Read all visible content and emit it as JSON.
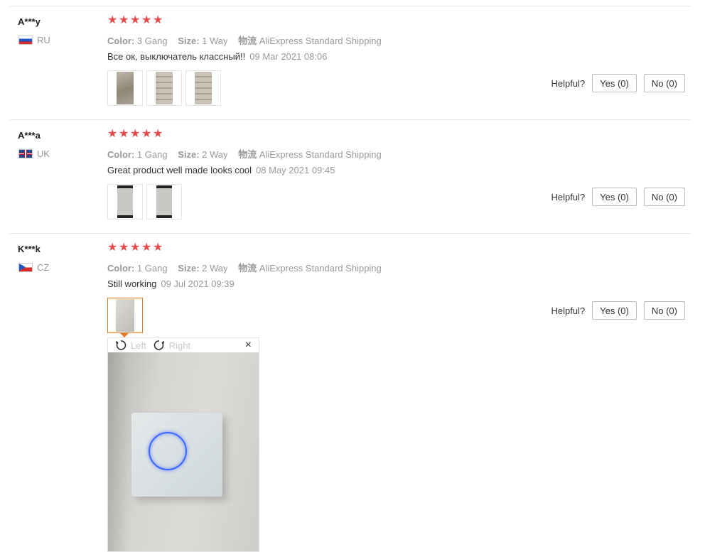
{
  "helpful_label": "Helpful?",
  "star_color": "#e94a4a",
  "reviews": [
    {
      "user": "A***y",
      "country": "RU",
      "flag_icon": "ru-flag-icon",
      "rating": 5,
      "color_label": "Color:",
      "color_value": "3 Gang",
      "size_label": "Size:",
      "size_value": "1 Way",
      "shipping_label": "物流",
      "shipping_value": "AliExpress Standard Shipping",
      "comment": "Все ок, выключатель классный!!",
      "date": "09 Mar 2021 08:06",
      "yes": "Yes (0)",
      "no": "No (0)"
    },
    {
      "user": "A***a",
      "country": "UK",
      "flag_icon": "uk-flag-icon",
      "rating": 5,
      "color_label": "Color:",
      "color_value": "1 Gang",
      "size_label": "Size:",
      "size_value": "2 Way",
      "shipping_label": "物流",
      "shipping_value": "AliExpress Standard Shipping",
      "comment": "Great product well made looks cool",
      "date": "08 May 2021 09:45",
      "yes": "Yes (0)",
      "no": "No (0)"
    },
    {
      "user": "K***k",
      "country": "CZ",
      "flag_icon": "cz-flag-icon",
      "rating": 5,
      "color_label": "Color:",
      "color_value": "1 Gang",
      "size_label": "Size:",
      "size_value": "2 Way",
      "shipping_label": "物流",
      "shipping_value": "AliExpress Standard Shipping",
      "comment": "Still working",
      "date": "09 Jul 2021 09:39",
      "yes": "Yes (0)",
      "no": "No (0)"
    }
  ],
  "viewer": {
    "rotate_left": "Left",
    "rotate_right": "Right",
    "close": "×"
  }
}
